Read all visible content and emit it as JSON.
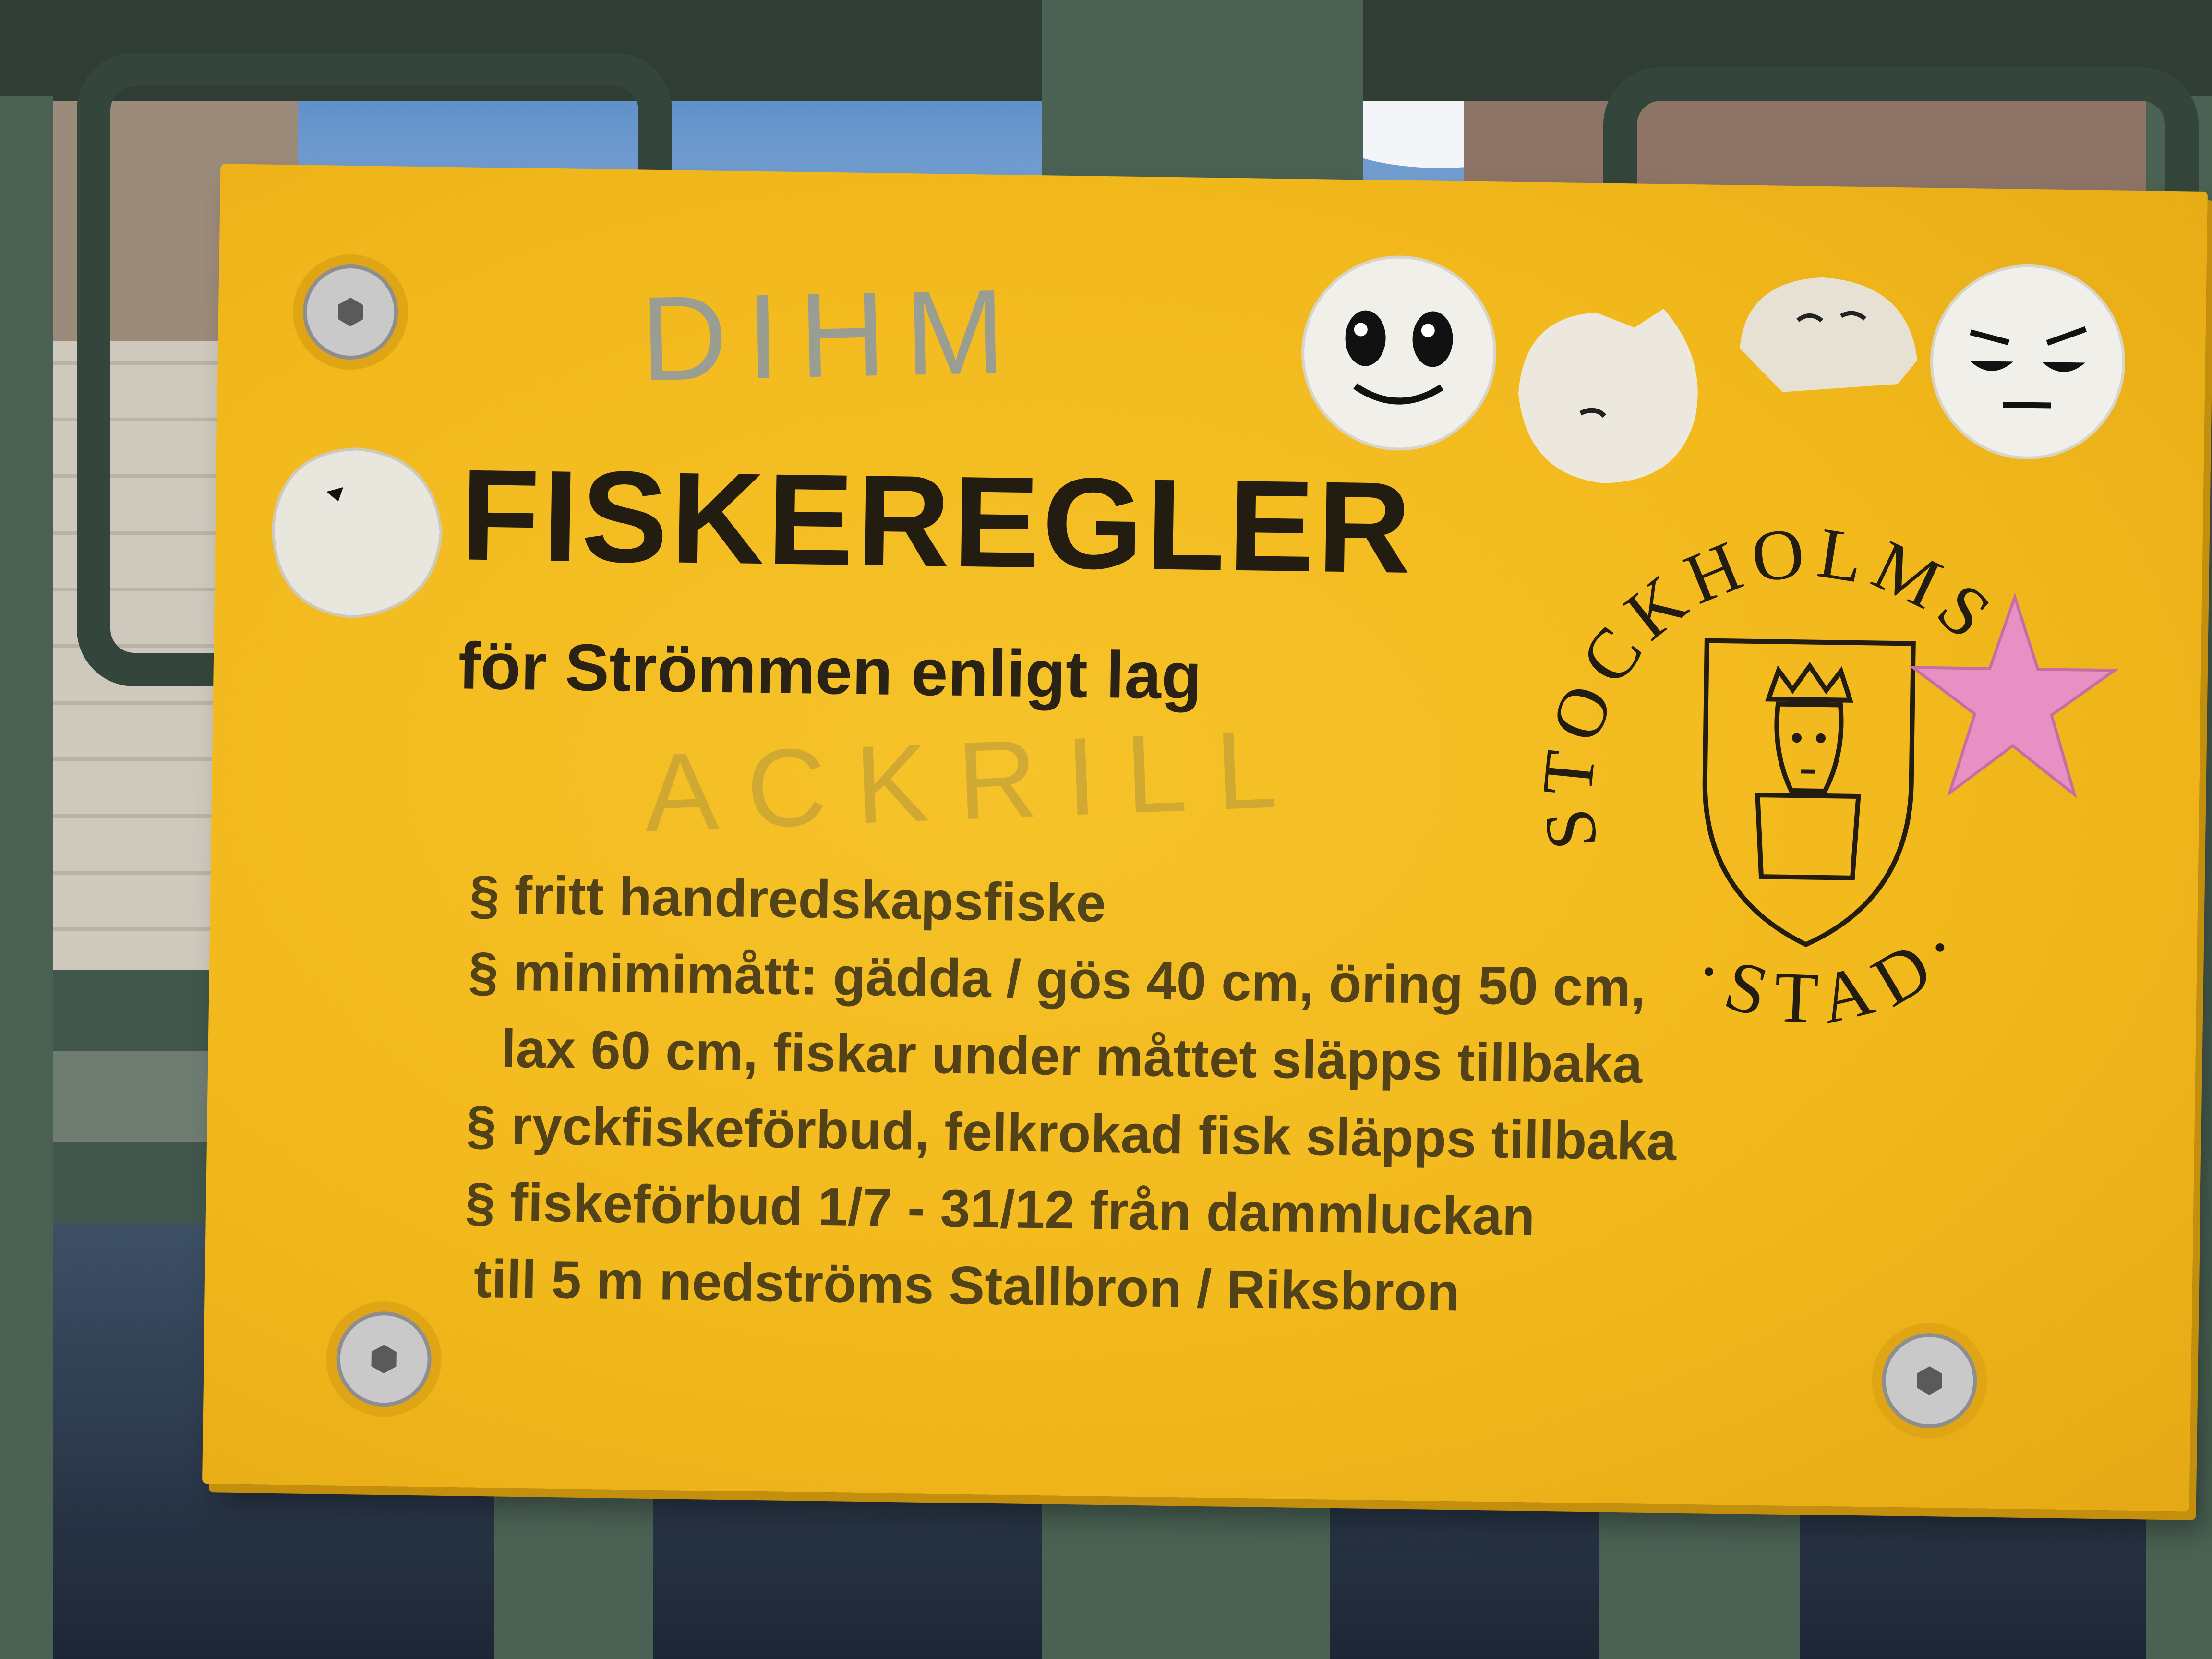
{
  "sign": {
    "title": "FISKEREGLER",
    "subtitle": "för Strömmen enligt lag",
    "rules": [
      "§ fritt handredskapsfiske",
      "§ minimimått: gädda / gös 40 cm, öring 50 cm,",
      "lax 60 cm, fiskar under måttet släpps tillbaka",
      "§ ryckfiskeförbud, felkrokad fisk släpps tillbaka",
      "§ fiskeförbud 1/7 - 31/12 från dammluckan",
      "till 5 m nedströms Stallbron / Riksbron"
    ],
    "seal_text": "STOCKHOLMS · STAD ·",
    "background_color": "#f2b91c",
    "text_color": "#231c10"
  },
  "graffiti": {
    "top": "DIHM",
    "middle": "ACKRILL"
  },
  "stickers": [
    "smiley-face",
    "peeled-face",
    "peeled-face",
    "skeptical-face",
    "peeled-sticker",
    "pink-star"
  ],
  "railing_color": "#41574b"
}
